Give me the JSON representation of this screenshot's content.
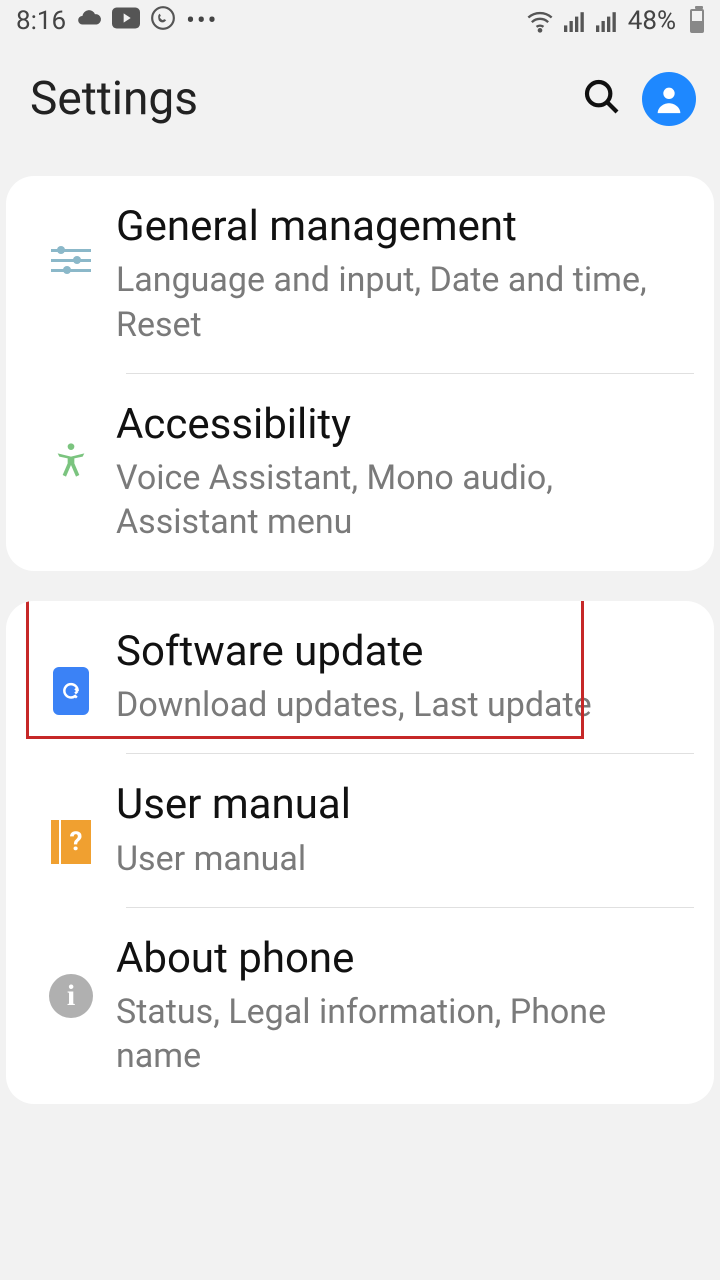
{
  "status": {
    "time": "8:16",
    "battery_pct": "48%"
  },
  "header": {
    "title": "Settings"
  },
  "groups": [
    {
      "items": [
        {
          "title": "General management",
          "sub": "Language and input, Date and time, Reset"
        },
        {
          "title": "Accessibility",
          "sub": "Voice Assistant, Mono audio, Assistant menu"
        }
      ]
    },
    {
      "items": [
        {
          "title": "Software update",
          "sub": "Download updates, Last update",
          "highlighted": true
        },
        {
          "title": "User manual",
          "sub": "User manual"
        },
        {
          "title": "About phone",
          "sub": "Status, Legal information, Phone name"
        }
      ]
    }
  ]
}
